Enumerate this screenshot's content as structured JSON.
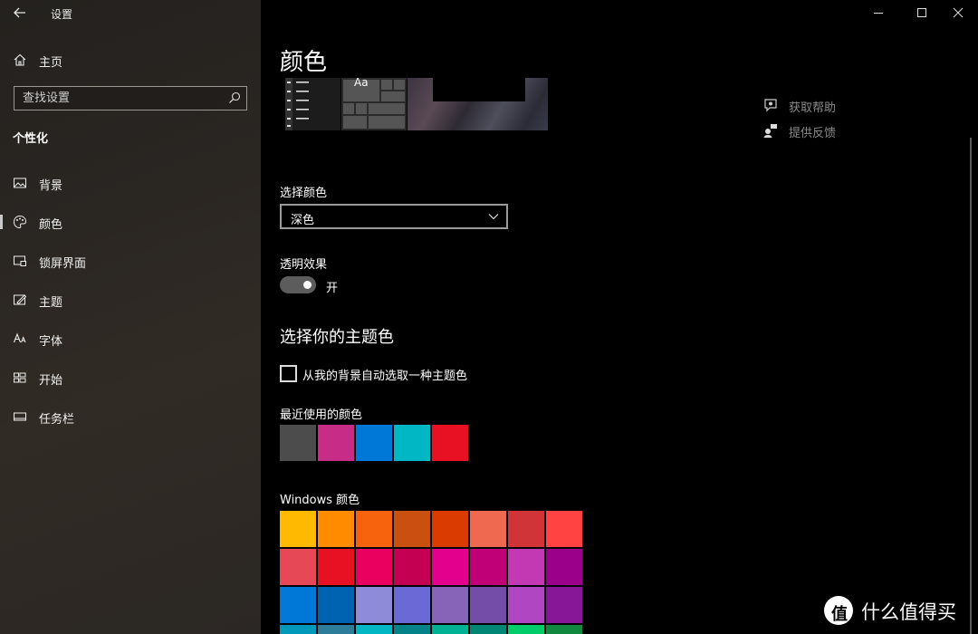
{
  "app_title": "设置",
  "sidebar": {
    "home_label": "主页",
    "search_placeholder": "查找设置",
    "section_title": "个性化",
    "items": [
      {
        "label": "背景",
        "icon": "image-icon"
      },
      {
        "label": "颜色",
        "icon": "palette-icon",
        "selected": true
      },
      {
        "label": "锁屏界面",
        "icon": "lock-screen-icon"
      },
      {
        "label": "主题",
        "icon": "themes-icon"
      },
      {
        "label": "字体",
        "icon": "font-icon"
      },
      {
        "label": "开始",
        "icon": "start-icon"
      },
      {
        "label": "任务栏",
        "icon": "taskbar-icon"
      }
    ]
  },
  "main": {
    "title": "颜色",
    "preview_tile_text": "Aa",
    "help": {
      "get_help": "获取帮助",
      "feedback": "提供反馈"
    },
    "choose_color_label": "选择颜色",
    "choose_color_value": "深色",
    "transparency_label": "透明效果",
    "transparency_state": "开",
    "accent_heading": "选择你的主题色",
    "auto_accent_label": "从我的背景自动选取一种主题色",
    "auto_accent_checked": false,
    "recent_colors_label": "最近使用的颜色",
    "recent_colors": [
      "#4c4c4c",
      "#c72d86",
      "#0078d7",
      "#00b7c3",
      "#e81123"
    ],
    "windows_colors_label": "Windows 颜色",
    "windows_colors": [
      [
        "#ffb900",
        "#ff8c00",
        "#f7630c",
        "#ca5010",
        "#da3b01",
        "#ef6950",
        "#d13438",
        "#ff4343"
      ],
      [
        "#e74856",
        "#e81123",
        "#ea005e",
        "#c30052",
        "#e3008c",
        "#bf0077",
        "#c239b3",
        "#9a0089"
      ],
      [
        "#0078d7",
        "#0063b1",
        "#8e8cd8",
        "#6b69d6",
        "#8764b8",
        "#744da9",
        "#b146c2",
        "#881798"
      ],
      [
        "#0099bc",
        "#2d7d9a",
        "#00b7c3",
        "#038387",
        "#00b294",
        "#018574",
        "#00cc6a",
        "#10893e"
      ]
    ]
  },
  "watermark": {
    "logo_char": "值",
    "text": "什么值得买"
  }
}
